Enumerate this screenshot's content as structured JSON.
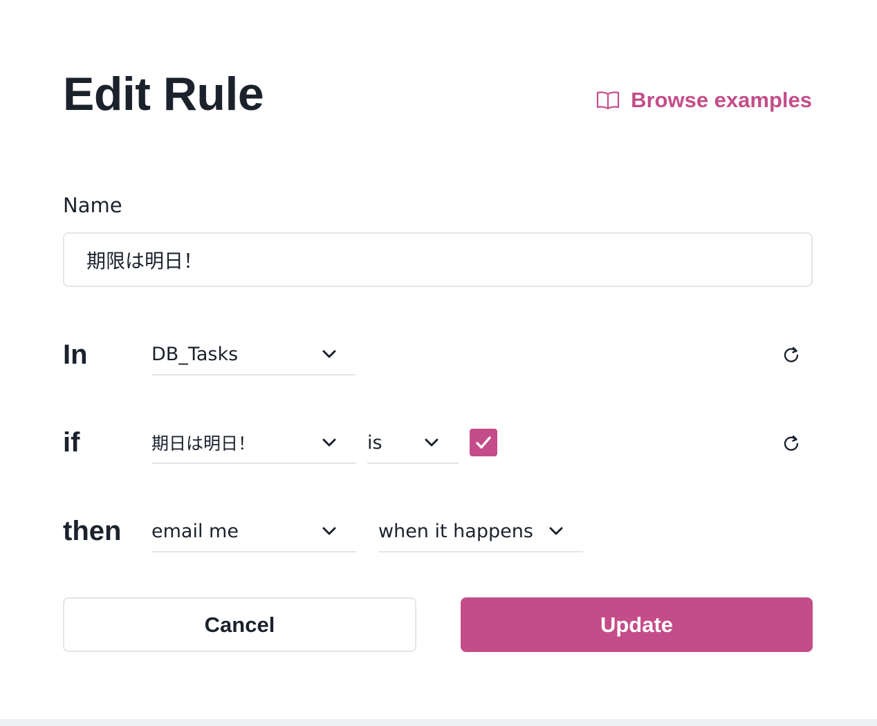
{
  "header": {
    "title": "Edit Rule",
    "browse_label": "Browse examples",
    "browse_icon": "book-open-icon"
  },
  "form": {
    "name_label": "Name",
    "name_value": "期限は明日！",
    "in_row": {
      "label": "In",
      "database": "DB_Tasks"
    },
    "if_row": {
      "label": "if",
      "property": "期日は明日！",
      "operator": "is",
      "checked": true
    },
    "then_row": {
      "label": "then",
      "action": "email me",
      "timing": "when it happens"
    }
  },
  "actions": {
    "cancel_label": "Cancel",
    "update_label": "Update"
  },
  "colors": {
    "accent": "#c44d89",
    "text": "#1b222c",
    "border": "#e3e5ea"
  }
}
